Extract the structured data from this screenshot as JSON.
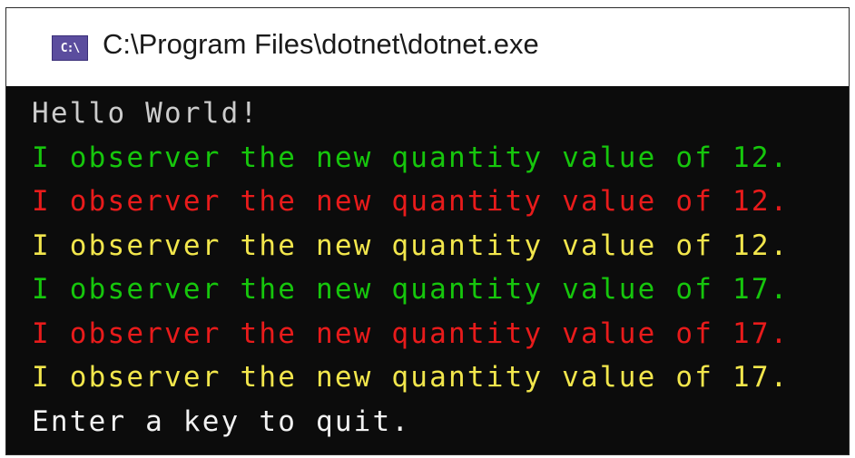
{
  "window": {
    "title": "C:\\Program Files\\dotnet\\dotnet.exe",
    "icon": {
      "name": "console-app-icon",
      "text": "C:\\"
    }
  },
  "console": {
    "lines": [
      {
        "text": "Hello World!",
        "color": "#cccccc"
      },
      {
        "text": "I observer the new quantity value of 12.",
        "color": "#16c60c"
      },
      {
        "text": "I observer the new quantity value of 12.",
        "color": "#e81b1b"
      },
      {
        "text": "I observer the new quantity value of 12.",
        "color": "#f2e64c"
      },
      {
        "text": "I observer the new quantity value of 17.",
        "color": "#16c60c"
      },
      {
        "text": "I observer the new quantity value of 17.",
        "color": "#e81b1b"
      },
      {
        "text": "I observer the new quantity value of 17.",
        "color": "#f2e64c"
      },
      {
        "text": "Enter a key to quit.",
        "color": "#f2f2f2"
      }
    ]
  }
}
